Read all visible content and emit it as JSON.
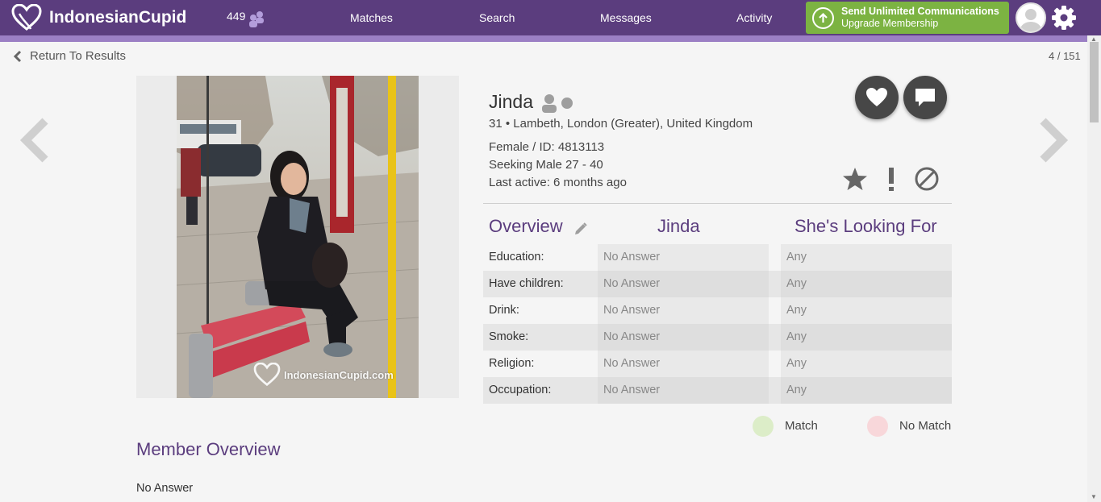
{
  "header": {
    "brand": "IndonesianCupid",
    "online_count": "449",
    "nav": [
      "Matches",
      "Search",
      "Messages",
      "Activity"
    ],
    "upgrade_title": "Send Unlimited Communications",
    "upgrade_subtitle": "Upgrade Membership",
    "colors": {
      "bar": "#5b3d7e",
      "stripe": "#9b7fc4",
      "upgrade": "#7cb342"
    }
  },
  "nav_back": "Return To Results",
  "pager": "4 / 151",
  "photo": {
    "watermark": "IndonesianCupid.com"
  },
  "profile": {
    "name": "Jinda",
    "location": "31 • Lambeth, London (Greater), United Kingdom",
    "gender_id": "Female / ID: 4813113",
    "seeking": "Seeking Male 27 - 40",
    "last_active": "Last active: 6 months ago"
  },
  "overview": {
    "title": "Overview",
    "col_member": "Jinda",
    "col_looking": "She's Looking For",
    "rows": [
      {
        "label": "Education:",
        "member": "No Answer",
        "looking": "Any"
      },
      {
        "label": "Have children:",
        "member": "No Answer",
        "looking": "Any"
      },
      {
        "label": "Drink:",
        "member": "No Answer",
        "looking": "Any"
      },
      {
        "label": "Smoke:",
        "member": "No Answer",
        "looking": "Any"
      },
      {
        "label": "Religion:",
        "member": "No Answer",
        "looking": "Any"
      },
      {
        "label": "Occupation:",
        "member": "No Answer",
        "looking": "Any"
      }
    ]
  },
  "legend": {
    "match": "Match",
    "no_match": "No Match",
    "colors": {
      "match": "#dcedc8",
      "no_match": "#f8d7da"
    }
  },
  "member_overview": {
    "title": "Member Overview",
    "text": "No Answer"
  }
}
